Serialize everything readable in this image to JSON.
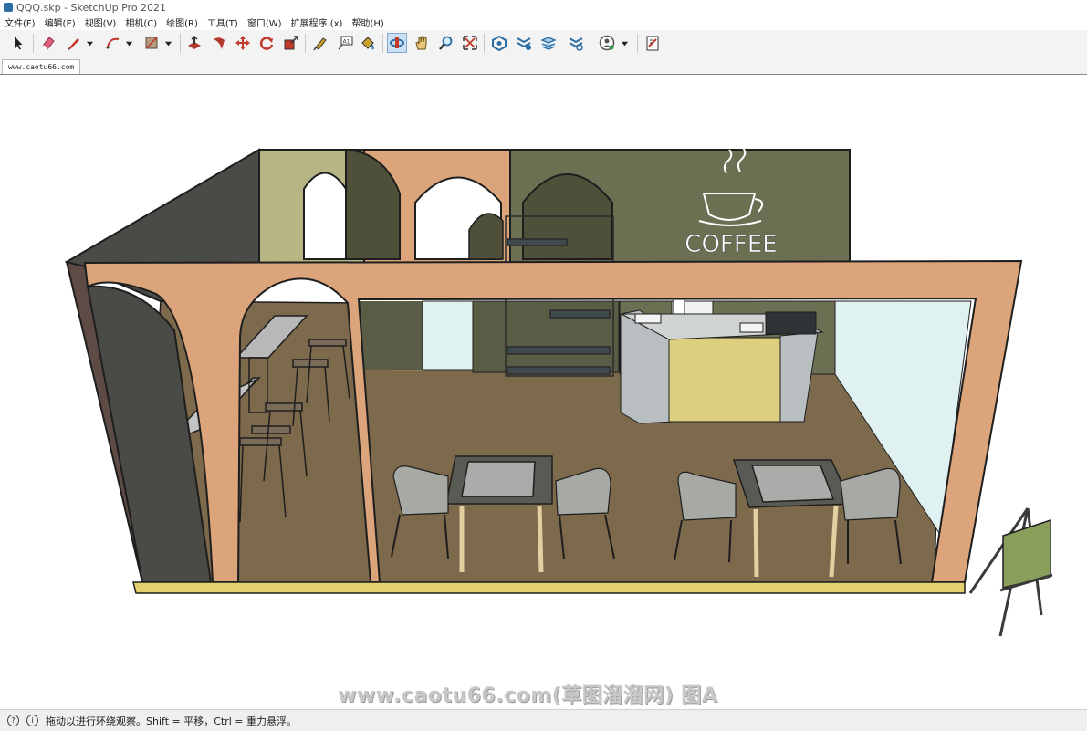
{
  "window": {
    "title": "QQQ.skp - SketchUp Pro 2021"
  },
  "menu": [
    "文件(F)",
    "编辑(E)",
    "视图(V)",
    "相机(C)",
    "绘图(R)",
    "工具(T)",
    "窗口(W)",
    "扩展程序 (x)",
    "帮助(H)"
  ],
  "toolbar": {
    "tools": [
      {
        "icon": "select-arrow-icon",
        "color": "#222222"
      },
      {
        "icon": "eraser-icon",
        "color": "#e0607e"
      },
      {
        "icon": "pencil-line-icon",
        "color": "#c0392b"
      },
      {
        "icon": "arc-icon",
        "color": "#c0392b"
      },
      {
        "icon": "rectangle-icon",
        "color": "#8e6e53"
      },
      {
        "icon": "push-pull-icon",
        "color": "#b03a2e"
      },
      {
        "icon": "follow-me-icon",
        "color": "#b03a2e"
      },
      {
        "icon": "move-icon",
        "color": "#c0392b"
      },
      {
        "icon": "rotate-icon",
        "color": "#c0392b"
      },
      {
        "icon": "scale-icon",
        "color": "#c0392b"
      },
      {
        "icon": "tape-measure-icon",
        "color": "#c9a227"
      },
      {
        "icon": "text-label-icon",
        "color": "#333333"
      },
      {
        "icon": "paint-bucket-icon",
        "color": "#c9a227"
      },
      {
        "icon": "orbit-icon",
        "color": "#2c6ea4"
      },
      {
        "icon": "pan-hand-icon",
        "color": "#c9a227"
      },
      {
        "icon": "zoom-icon",
        "color": "#2c6ea4"
      },
      {
        "icon": "zoom-extents-icon",
        "color": "#c0392b"
      },
      {
        "icon": "warehouse-icon",
        "color": "#2c6ea4"
      },
      {
        "icon": "extension-warehouse-icon",
        "color": "#2c6ea4"
      },
      {
        "icon": "layers-icon",
        "color": "#2c6ea4"
      },
      {
        "icon": "extension-manager-icon",
        "color": "#2c6ea4"
      },
      {
        "icon": "user-account-icon",
        "color": "#555555"
      },
      {
        "icon": "layout-icon",
        "color": "#c0392b"
      }
    ]
  },
  "tabs": [
    {
      "label": "www.caotu66.com"
    }
  ],
  "scene": {
    "sign_text": "COFFEE",
    "colors": {
      "wall_dark": "#4a4a47",
      "wall_olive": "#6c6f52",
      "wall_khaki": "#b8b585",
      "frame_orange": "#dba47a",
      "floor": "#7d6a4c",
      "counter": "#dccf7d",
      "window_glass": "#dff1f1"
    }
  },
  "watermark": "www.caotu66.com(草图溜溜网) 图A",
  "statusbar": {
    "message": "拖动以进行环绕观察。Shift = 平移，Ctrl = 重力悬浮。"
  }
}
